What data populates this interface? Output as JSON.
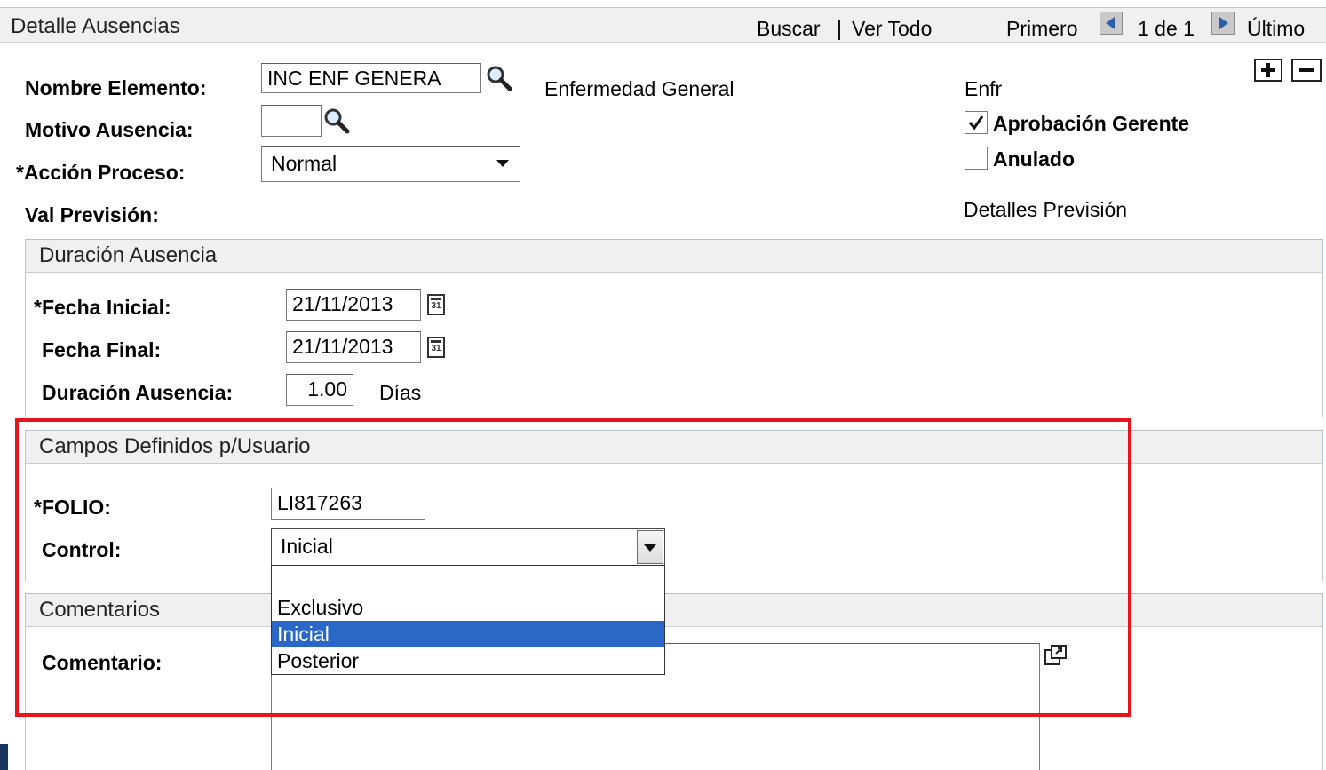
{
  "header": {
    "title": "Detalle Ausencias",
    "search_link": "Buscar",
    "separator": "|",
    "view_all_link": "Ver Todo",
    "first": "Primero",
    "counter": "1 de 1",
    "last": "Último"
  },
  "form": {
    "nombre_elemento": {
      "label": "Nombre Elemento:",
      "value": "INC ENF GENERA",
      "description": "Enfermedad General",
      "short": "Enfr"
    },
    "motivo_ausencia": {
      "label": "Motivo Ausencia:",
      "value": ""
    },
    "accion_proceso": {
      "label": "*Acción Proceso:",
      "value": "Normal"
    },
    "val_prevision": {
      "label": "Val Previsión:"
    },
    "aprobacion_gerente": {
      "label": "Aprobación Gerente",
      "checked": true
    },
    "anulado": {
      "label": "Anulado",
      "checked": false
    },
    "detalles_prevision_link": "Detalles Previsión"
  },
  "duracion": {
    "title": "Duración Ausencia",
    "fecha_inicial": {
      "label": "*Fecha Inicial:",
      "value": "21/11/2013"
    },
    "fecha_final": {
      "label": "Fecha Final:",
      "value": "21/11/2013"
    },
    "duracion": {
      "label": "Duración Ausencia:",
      "value": "1.00",
      "unit": "Días"
    },
    "calendar_glyph": "31"
  },
  "campos": {
    "title": "Campos Definidos p/Usuario",
    "folio": {
      "label": "*FOLIO:",
      "value": "LI817263"
    },
    "control": {
      "label": "Control:",
      "value": "Inicial",
      "options": [
        "",
        "Exclusivo",
        "Inicial",
        "Posterior"
      ],
      "selected_index": 2
    }
  },
  "comentarios": {
    "title": "Comentarios",
    "comentario": {
      "label": "Comentario:",
      "value": ""
    }
  },
  "colors": {
    "highlight_box": "#e8141b",
    "dropdown_selected": "#2a67c6",
    "group_header_bg": "#f0f0f0"
  },
  "icons": {
    "lookup": "magnifier-icon",
    "calendar": "calendar-icon",
    "add_row": "plus-icon",
    "delete_row": "minus-icon",
    "expand": "expand-icon",
    "prev": "arrow-left-icon",
    "next": "arrow-right-icon"
  }
}
